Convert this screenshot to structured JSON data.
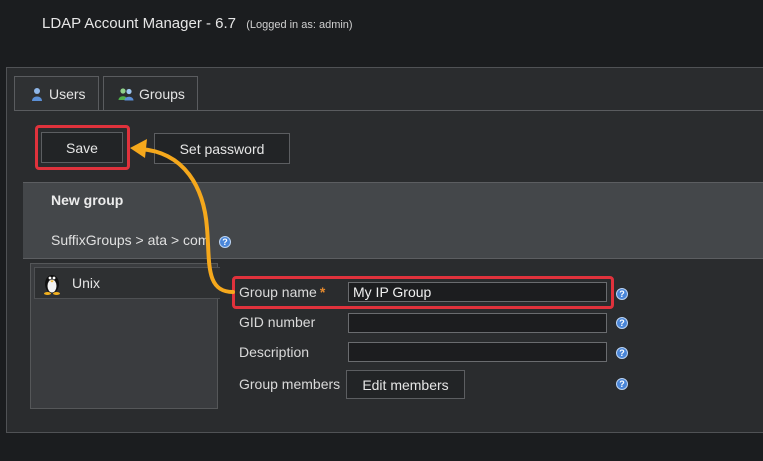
{
  "app": {
    "title": "LDAP Account Manager - 6.7",
    "login": "(Logged in as: admin)"
  },
  "tabs": [
    {
      "label": "Users",
      "icon": "user-icon"
    },
    {
      "label": "Groups",
      "icon": "group-icon"
    }
  ],
  "toolbar": {
    "save_label": "Save",
    "setpw_label": "Set password"
  },
  "header": {
    "title": "New group",
    "dn": "SuffixGroups > ata > com"
  },
  "modules": [
    {
      "label": "Unix",
      "icon": "tux-icon"
    }
  ],
  "form": {
    "group_name": {
      "label": "Group name",
      "required": "*",
      "value": "My IP Group"
    },
    "gid": {
      "label": "GID number",
      "value": ""
    },
    "description": {
      "label": "Description",
      "value": ""
    },
    "members": {
      "label": "Group members",
      "button": "Edit members"
    }
  },
  "help_glyph": "?",
  "colors": {
    "highlight": "#e0323c",
    "arrow": "#f5a81c",
    "help": "#4a86d8"
  }
}
